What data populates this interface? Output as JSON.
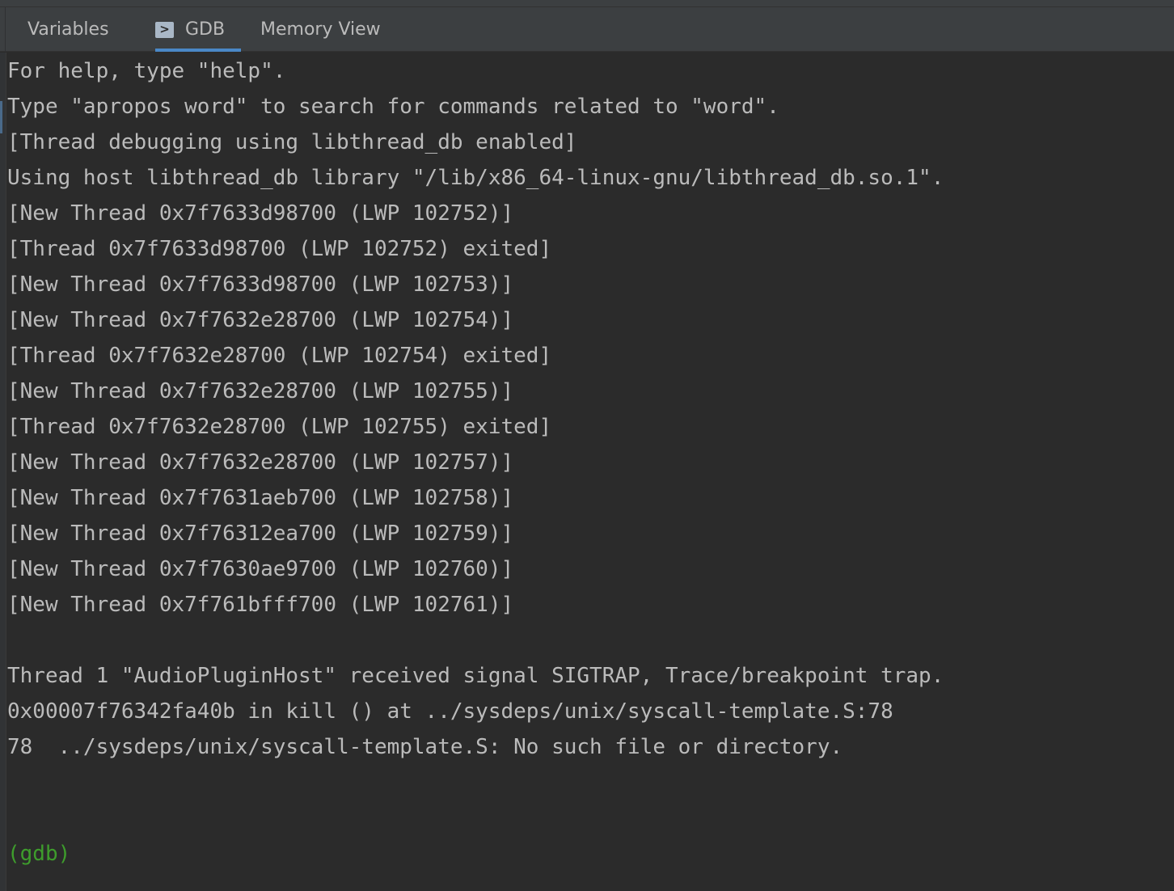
{
  "tabs": {
    "variables": "Variables",
    "gdb": "GDB",
    "memory_view": "Memory View"
  },
  "console": {
    "lines": [
      "For help, type \"help\".",
      "Type \"apropos word\" to search for commands related to \"word\".",
      "[Thread debugging using libthread_db enabled]",
      "Using host libthread_db library \"/lib/x86_64-linux-gnu/libthread_db.so.1\".",
      "[New Thread 0x7f7633d98700 (LWP 102752)]",
      "[Thread 0x7f7633d98700 (LWP 102752) exited]",
      "[New Thread 0x7f7633d98700 (LWP 102753)]",
      "[New Thread 0x7f7632e28700 (LWP 102754)]",
      "[Thread 0x7f7632e28700 (LWP 102754) exited]",
      "[New Thread 0x7f7632e28700 (LWP 102755)]",
      "[Thread 0x7f7632e28700 (LWP 102755) exited]",
      "[New Thread 0x7f7632e28700 (LWP 102757)]",
      "[New Thread 0x7f7631aeb700 (LWP 102758)]",
      "[New Thread 0x7f76312ea700 (LWP 102759)]",
      "[New Thread 0x7f7630ae9700 (LWP 102760)]",
      "[New Thread 0x7f761bfff700 (LWP 102761)]",
      "Thread 1 \"AudioPluginHost\" received signal SIGTRAP, Trace/breakpoint trap.",
      "0x00007f76342fa40b in kill () at ../sysdeps/unix/syscall-template.S:78",
      "78  ../sysdeps/unix/syscall-template.S: No such file or directory."
    ],
    "prompt": "(gdb)"
  },
  "colors": {
    "background": "#2b2b2b",
    "text": "#bbbbbb",
    "prompt": "#3e9d2c",
    "tab_underline": "#4a88c7"
  },
  "icons": {
    "gdb_tab": "console-icon"
  }
}
